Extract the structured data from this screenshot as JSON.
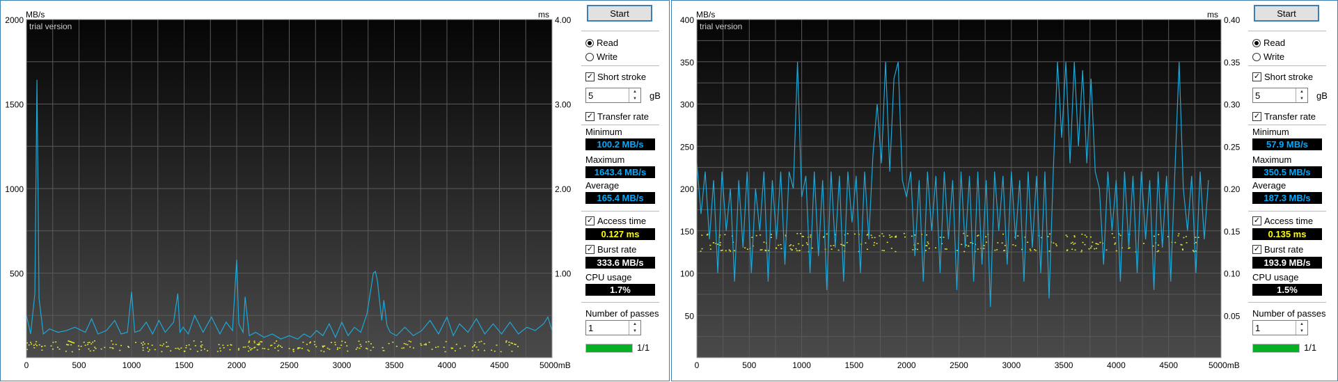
{
  "panels": [
    {
      "start_label": "Start",
      "chart_data": {
        "type": "line",
        "y_unit": "MB/s",
        "y2_unit": "ms",
        "x_unit": "mB",
        "watermark": "trial version",
        "ylim": [
          0,
          2000
        ],
        "y2lim": [
          0,
          4.0
        ],
        "xlim": [
          0,
          5000
        ],
        "y_ticks": [
          "500",
          "1000",
          "1500",
          "2000"
        ],
        "y2_ticks": [
          "1.00",
          "2.00",
          "3.00",
          "4.00"
        ],
        "x_ticks": [
          "0",
          "500",
          "1000",
          "1500",
          "2000",
          "2500",
          "3000",
          "3500",
          "4000",
          "4500",
          "5000mB"
        ],
        "grid": true,
        "series": [
          {
            "color": "#1ea8d8",
            "x": [
              0,
              40,
              80,
              100,
              120,
              160,
              220,
              300,
              380,
              460,
              560,
              620,
              680,
              760,
              840,
              900,
              960,
              1000,
              1030,
              1080,
              1140,
              1200,
              1260,
              1320,
              1400,
              1440,
              1460,
              1490,
              1540,
              1600,
              1680,
              1760,
              1840,
              1900,
              1960,
              2000,
              2020,
              2060,
              2080,
              2120,
              2180,
              2260,
              2340,
              2420,
              2500,
              2580,
              2640,
              2700,
              2760,
              2820,
              2880,
              2940,
              3000,
              3060,
              3120,
              3180,
              3240,
              3280,
              3300,
              3320,
              3340,
              3360,
              3380,
              3400,
              3430,
              3460,
              3520,
              3600,
              3680,
              3760,
              3840,
              3920,
              4000,
              4060,
              4120,
              4200,
              4280,
              4360,
              4440,
              4520,
              4600,
              4680,
              4760,
              4840,
              4920,
              4960,
              5000
            ],
            "y": [
              250,
              140,
              380,
              1643,
              350,
              140,
              170,
              150,
              160,
              180,
              150,
              230,
              140,
              160,
              220,
              140,
              150,
              390,
              150,
              160,
              210,
              140,
              220,
              150,
              210,
              380,
              150,
              180,
              140,
              250,
              150,
              240,
              140,
              210,
              160,
              580,
              200,
              150,
              360,
              130,
              150,
              120,
              140,
              110,
              130,
              110,
              140,
              120,
              160,
              130,
              200,
              120,
              210,
              130,
              180,
              150,
              260,
              420,
              500,
              510,
              450,
              330,
              220,
              340,
              190,
              150,
              130,
              180,
              130,
              160,
              220,
              140,
              240,
              130,
              200,
              150,
              230,
              140,
              200,
              140,
              210,
              140,
              180,
              160,
              200,
              240,
              160
            ]
          }
        ]
      },
      "controls": {
        "read_label": "Read",
        "write_label": "Write",
        "short_stroke_label": "Short stroke",
        "short_stroke_value": "5",
        "short_stroke_unit": "gB",
        "transfer_rate_label": "Transfer rate",
        "minimum_label": "Minimum",
        "minimum_value": "100.2 MB/s",
        "maximum_label": "Maximum",
        "maximum_value": "1643.4 MB/s",
        "average_label": "Average",
        "average_value": "165.4 MB/s",
        "access_time_label": "Access time",
        "access_time_value": "0.127 ms",
        "burst_rate_label": "Burst rate",
        "burst_rate_value": "333.6 MB/s",
        "cpu_usage_label": "CPU usage",
        "cpu_usage_value": "1.7%",
        "passes_label": "Number of passes",
        "passes_value": "1",
        "progress_text": "1/1",
        "progress_fraction": 1.0
      }
    },
    {
      "start_label": "Start",
      "chart_data": {
        "type": "line",
        "y_unit": "MB/s",
        "y2_unit": "ms",
        "x_unit": "mB",
        "watermark": "trial version",
        "ylim": [
          0,
          400
        ],
        "y2lim": [
          0,
          0.4
        ],
        "xlim": [
          0,
          5000
        ],
        "y_ticks": [
          "50",
          "100",
          "150",
          "200",
          "250",
          "300",
          "350",
          "400"
        ],
        "y2_ticks": [
          "0.05",
          "0.10",
          "0.15",
          "0.20",
          "0.25",
          "0.30",
          "0.35",
          "0.40"
        ],
        "x_ticks": [
          "0",
          "500",
          "1000",
          "1500",
          "2000",
          "2500",
          "3000",
          "3500",
          "4000",
          "4500",
          "5000mB"
        ],
        "grid": true,
        "series": [
          {
            "color": "#1ea8d8",
            "x": [
              0,
              40,
              80,
              120,
              160,
              200,
              240,
              280,
              320,
              360,
              400,
              440,
              480,
              520,
              560,
              600,
              640,
              680,
              720,
              760,
              800,
              840,
              880,
              920,
              960,
              1000,
              1040,
              1080,
              1120,
              1160,
              1200,
              1240,
              1280,
              1320,
              1360,
              1400,
              1440,
              1480,
              1520,
              1560,
              1600,
              1640,
              1680,
              1720,
              1760,
              1800,
              1840,
              1880,
              1920,
              1960,
              2000,
              2040,
              2080,
              2120,
              2160,
              2200,
              2240,
              2280,
              2320,
              2360,
              2400,
              2440,
              2480,
              2520,
              2560,
              2600,
              2640,
              2680,
              2720,
              2760,
              2800,
              2840,
              2880,
              2920,
              2960,
              3000,
              3040,
              3080,
              3120,
              3160,
              3200,
              3240,
              3280,
              3320,
              3360,
              3400,
              3440,
              3480,
              3520,
              3560,
              3600,
              3640,
              3680,
              3720,
              3760,
              3800,
              3840,
              3880,
              3920,
              3960,
              4000,
              4040,
              4080,
              4120,
              4160,
              4200,
              4240,
              4280,
              4320,
              4360,
              4400,
              4440,
              4480,
              4520,
              4560,
              4600,
              4640,
              4680,
              4720,
              4760,
              4800,
              4840,
              4880,
              4920,
              4960,
              5000
            ],
            "y": [
              230,
              170,
              220,
              140,
              210,
              100,
              220,
              150,
              200,
              90,
              210,
              130,
              220,
              100,
              200,
              150,
              220,
              90,
              210,
              140,
              220,
              110,
              220,
              200,
              350,
              190,
              215,
              100,
              220,
              120,
              210,
              80,
              220,
              130,
              215,
              90,
              220,
              160,
              215,
              100,
              220,
              140,
              240,
              300,
              230,
              350,
              220,
              330,
              350,
              210,
              190,
              220,
              120,
              210,
              90,
              220,
              150,
              215,
              100,
              220,
              140,
              210,
              80,
              220,
              130,
              215,
              90,
              220,
              110,
              210,
              60,
              220,
              150,
              215,
              110,
              220,
              140,
              210,
              90,
              220,
              130,
              215,
              100,
              220,
              70,
              220,
              350,
              260,
              350,
              230,
              350,
              250,
              340,
              230,
              330,
              220,
              200,
              110,
              220,
              150,
              210,
              90,
              220,
              130,
              215,
              100,
              220,
              140,
              210,
              80,
              220,
              130,
              215,
              90,
              220,
              350,
              200,
              150,
              215,
              100,
              220,
              140,
              210
            ]
          }
        ]
      },
      "controls": {
        "read_label": "Read",
        "write_label": "Write",
        "short_stroke_label": "Short stroke",
        "short_stroke_value": "5",
        "short_stroke_unit": "gB",
        "transfer_rate_label": "Transfer rate",
        "minimum_label": "Minimum",
        "minimum_value": "57.9 MB/s",
        "maximum_label": "Maximum",
        "maximum_value": "350.5 MB/s",
        "average_label": "Average",
        "average_value": "187.3 MB/s",
        "access_time_label": "Access time",
        "access_time_value": "0.135 ms",
        "burst_rate_label": "Burst rate",
        "burst_rate_value": "193.9 MB/s",
        "cpu_usage_label": "CPU usage",
        "cpu_usage_value": "1.5%",
        "passes_label": "Number of passes",
        "passes_value": "1",
        "progress_text": "1/1",
        "progress_fraction": 1.0
      }
    }
  ],
  "colors": {
    "transfer_line": "#1ea8d8",
    "access_dots": "#e8e830",
    "value_blue": "#00aaff",
    "value_yellow": "#ffff00",
    "value_white": "#ffffff"
  }
}
